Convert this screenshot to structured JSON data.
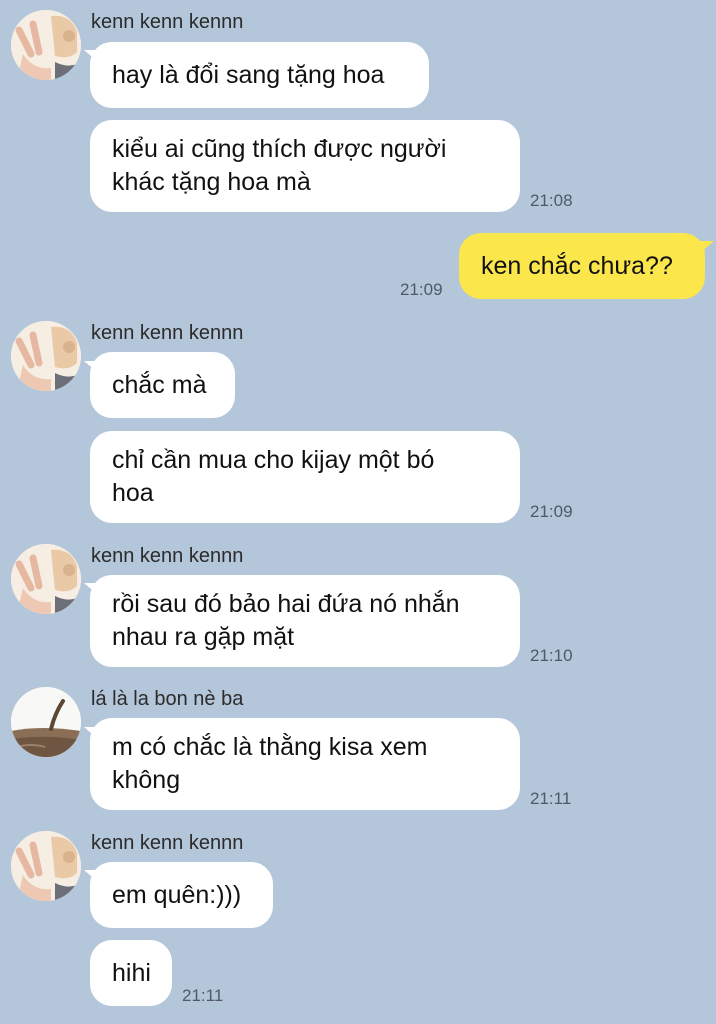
{
  "colors": {
    "background": "#b4c6d9",
    "incoming_bubble": "#ffffff",
    "outgoing_bubble": "#fbe64b"
  },
  "messages": {
    "g1": {
      "sender": "kenn kenn kennn",
      "avatar_icon": "peace-sign-avatar-icon",
      "m1": "hay là đổi sang tặng hoa",
      "m2": "kiểu ai cũng thích được người\nkhác tặng hoa mà",
      "time": "21:08"
    },
    "out1": {
      "text": "ken chắc chưa??",
      "time": "21:09"
    },
    "g2": {
      "sender": "kenn kenn kennn",
      "avatar_icon": "peace-sign-avatar-icon",
      "m1": "chắc mà",
      "m2": "chỉ cần mua cho kijay một bó\nhoa",
      "time": "21:09"
    },
    "g3": {
      "sender": "kenn kenn kennn",
      "avatar_icon": "peace-sign-avatar-icon",
      "m1": "rồi sau đó bảo hai đứa nó nhắn\nnhau ra gặp mặt",
      "time": "21:10"
    },
    "g4": {
      "sender": "lá là la bon nè ba",
      "avatar_icon": "landscape-avatar-icon",
      "m1": "m có chắc là thằng kisa xem\nkhông",
      "time": "21:11"
    },
    "g5": {
      "sender": "kenn kenn kennn",
      "avatar_icon": "peace-sign-avatar-icon",
      "m1": "em quên:)))",
      "m2": "hihi",
      "time": "21:11"
    }
  }
}
